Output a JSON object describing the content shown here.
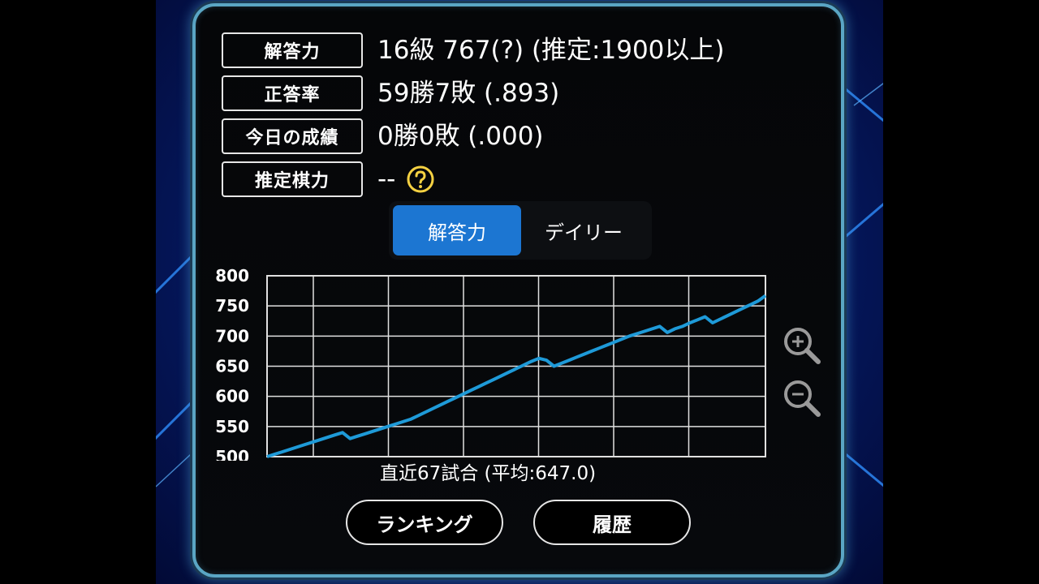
{
  "stats": [
    {
      "label": "解答力",
      "value": "16級 767(?) (推定:1900以上)"
    },
    {
      "label": "正答率",
      "value": "59勝7敗 (.893)"
    },
    {
      "label": "今日の成績",
      "value": "0勝0敗 (.000)"
    },
    {
      "label": "推定棋力",
      "value": "--"
    }
  ],
  "tabs": [
    {
      "label": "解答力",
      "active": true
    },
    {
      "label": "デイリー",
      "active": false
    }
  ],
  "chart_data": {
    "type": "line",
    "ylim": [
      500,
      800
    ],
    "yticks": [
      "800",
      "750",
      "700",
      "650",
      "600",
      "550",
      "500"
    ],
    "grid": true,
    "color": "#1e9ad8",
    "series": [
      {
        "values": [
          500,
          504,
          508,
          512,
          516,
          520,
          524,
          528,
          532,
          536,
          540,
          530,
          534,
          538,
          542,
          546,
          550,
          554,
          558,
          562,
          568,
          574,
          580,
          586,
          592,
          598,
          604,
          610,
          616,
          622,
          628,
          634,
          640,
          646,
          652,
          658,
          663,
          660,
          650,
          655,
          660,
          665,
          670,
          675,
          680,
          685,
          690,
          695,
          700,
          704,
          708,
          712,
          716,
          706,
          712,
          716,
          722,
          727,
          732,
          722,
          728,
          734,
          740,
          746,
          752,
          758,
          767
        ]
      }
    ]
  },
  "chart_caption": "直近67試合 (平均:647.0)",
  "buttons": {
    "ranking": "ランキング",
    "history": "履歴"
  },
  "colors": {
    "accent": "#1c76d2",
    "help": "#f5d142",
    "line": "#1e9ad8",
    "panel_border": "#5aa6c4"
  },
  "icons": {
    "help": "question-circle-icon",
    "zoom_in": "zoom-in-icon",
    "zoom_out": "zoom-out-icon"
  }
}
